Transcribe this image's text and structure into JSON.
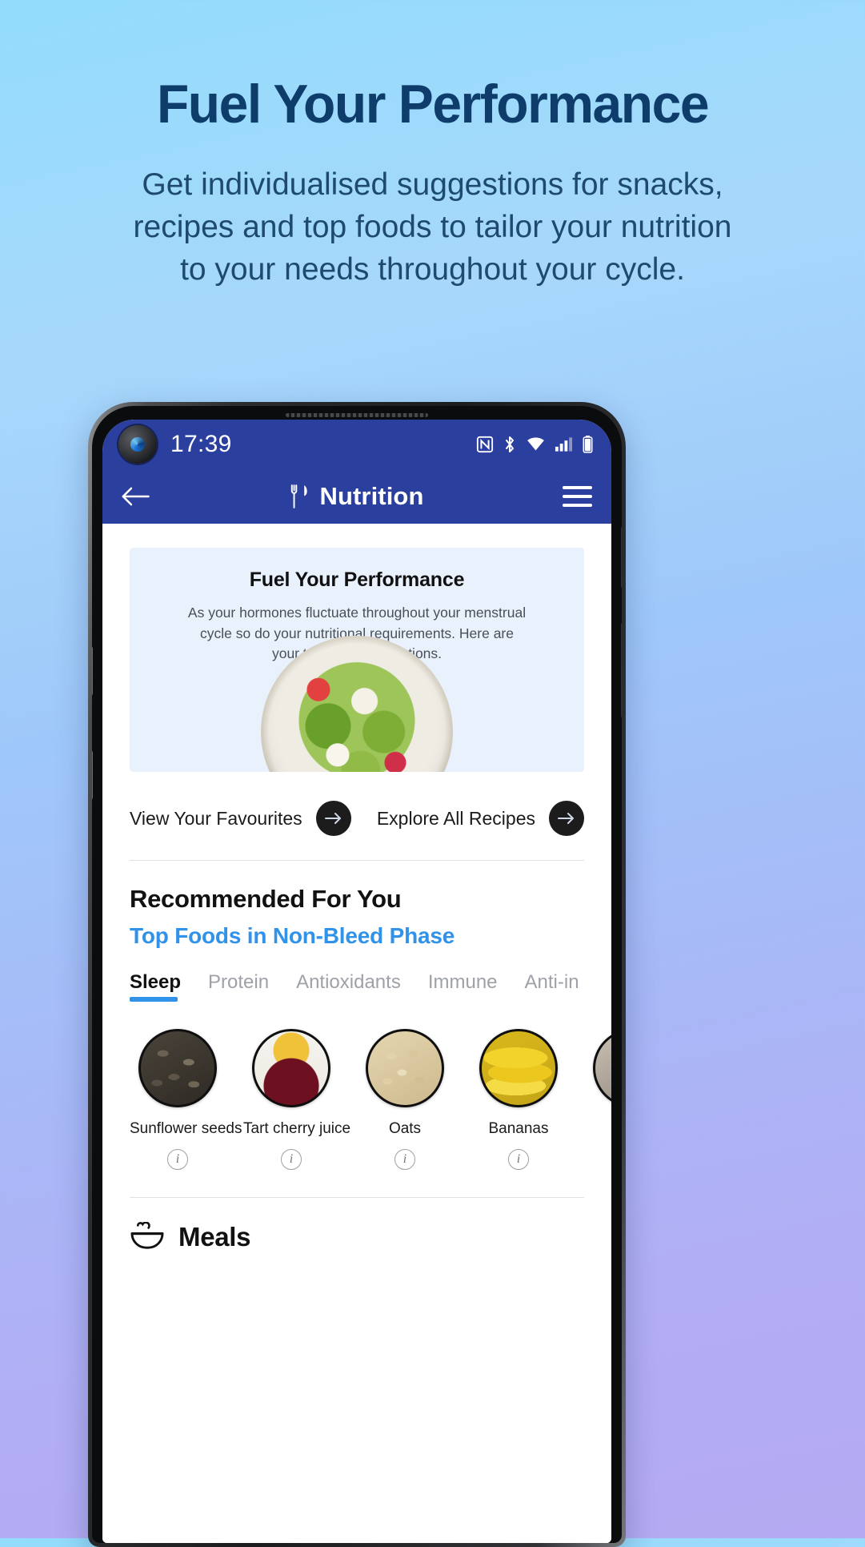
{
  "promo": {
    "title": "Fuel Your Performance",
    "subtitle": "Get individualised suggestions for snacks, recipes and top foods to tailor your nutrition to your needs throughout your cycle."
  },
  "phone": {
    "statusbar": {
      "time": "17:39",
      "icons": [
        "nfc-icon",
        "bluetooth-icon",
        "wifi-icon",
        "cellular-signal-icon",
        "battery-icon"
      ]
    },
    "appbar": {
      "back_icon": "back-arrow-icon",
      "title_icon": "fork-knife-icon",
      "title": "Nutrition",
      "menu_icon": "hamburger-menu-icon"
    },
    "hero": {
      "title": "Fuel Your Performance",
      "body": "As your hormones fluctuate throughout your menstrual cycle so do your nutritional requirements. Here are your top recommendations.",
      "image": "salad-bowl-photo"
    },
    "links": [
      {
        "label": "View Your Favourites",
        "icon": "arrow-right-icon"
      },
      {
        "label": "Explore All Recipes",
        "icon": "arrow-right-icon"
      }
    ],
    "recommended": {
      "heading": "Recommended For You",
      "subheading": "Top Foods in Non-Bleed Phase",
      "accent_color": "#3092e8",
      "tabs": [
        {
          "label": "Sleep",
          "active": true
        },
        {
          "label": "Protein",
          "active": false
        },
        {
          "label": "Antioxidants",
          "active": false
        },
        {
          "label": "Immune",
          "active": false
        },
        {
          "label": "Anti-in",
          "active": false
        }
      ],
      "foods": [
        {
          "name": "Sunflower seeds",
          "info_icon": "info-icon"
        },
        {
          "name": "Tart cherry juice",
          "info_icon": "info-icon"
        },
        {
          "name": "Oats",
          "info_icon": "info-icon"
        },
        {
          "name": "Bananas",
          "info_icon": "info-icon"
        }
      ]
    },
    "meals": {
      "icon": "meal-bowl-icon",
      "title": "Meals"
    }
  },
  "colors": {
    "headline": "#0e3d6b",
    "appbar": "#2b3f9e",
    "accent_blue": "#3092e8",
    "hero_card_bg": "#e9f1fd"
  }
}
